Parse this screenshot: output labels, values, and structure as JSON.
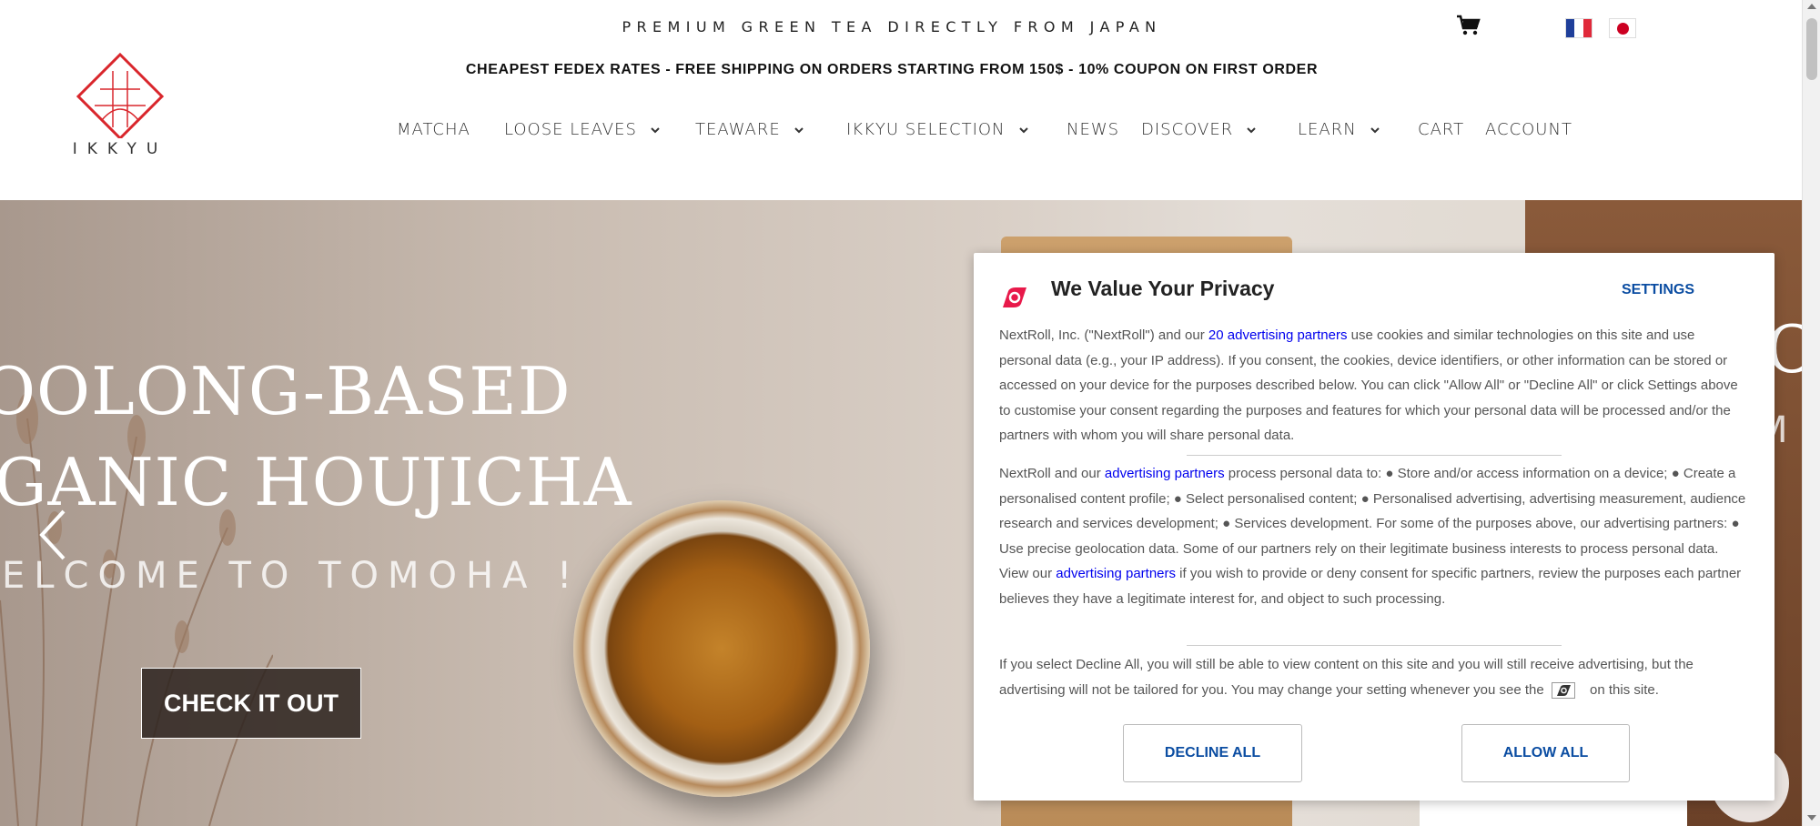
{
  "header": {
    "tagline": "PREMIUM GREEN TEA DIRECTLY FROM JAPAN",
    "promo": "CHEAPEST FEDEX RATES - FREE SHIPPING ON ORDERS STARTING FROM 150$ - 10% COUPON ON FIRST ORDER",
    "logo_text": "IKKYU",
    "brand_color": "#d9262c",
    "icons": [
      "cart-icon",
      "flag-france-icon",
      "flag-japan-icon"
    ]
  },
  "nav": {
    "items": [
      {
        "label": "MATCHA",
        "dropdown": false
      },
      {
        "label": "LOOSE LEAVES",
        "dropdown": true
      },
      {
        "label": "TEAWARE",
        "dropdown": true
      },
      {
        "label": "IKKYU SELECTION",
        "dropdown": true
      },
      {
        "label": "NEWS",
        "dropdown": false
      },
      {
        "label": "DISCOVER",
        "dropdown": true
      },
      {
        "label": "LEARN",
        "dropdown": true
      },
      {
        "label": "CART",
        "dropdown": false
      },
      {
        "label": "ACCOUNT",
        "dropdown": false
      }
    ]
  },
  "hero": {
    "line1": "OOLONG-BASED",
    "line2": "GANIC HOUJICHA",
    "line3": "ELCOME TO TOMOHA !",
    "cta": "CHECK IT OUT",
    "next_slide_line1": "CE",
    "next_slide_line2": "M"
  },
  "privacy": {
    "title": "We Value Your Privacy",
    "settings": "SETTINGS",
    "p1_before": "NextRoll, Inc. (\"NextRoll\") and our ",
    "p1_link": "20 advertising partners",
    "p1_after": " use cookies and similar technologies on this site and use personal data (e.g., your IP address). If you consent, the cookies, device identifiers, or other information can be stored or accessed on your device for the purposes described below. You can click \"Allow All\" or \"Decline All\" or click Settings above to customise your consent regarding the purposes and features for which your personal data will be processed and/or the partners with whom you will share personal data.",
    "p2_before": "NextRoll and our ",
    "p2_link": "advertising partners",
    "p2_middle": " process personal data to: ● Store and/or access information on a device; ● Create a personalised content profile; ● Select personalised content; ● Personalised advertising, advertising measurement, audience research and services development; ● Services development. For some of the purposes above, our advertising partners: ● Use precise geolocation data. Some of our partners rely on their legitimate business interests to process personal data. View our ",
    "p2_link2": "advertising partners",
    "p2_after": " if you wish to provide or deny consent for specific partners, review the purposes each partner believes they have a legitimate interest for, and object to such processing.",
    "p3_before": "If you select Decline All, you will still be able to view content on this site and you will still receive advertising, but the advertising will not be tailored for you. You may change your setting whenever you see the ",
    "p3_after": " on this site.",
    "decline": "DECLINE ALL",
    "allow": "ALLOW ALL",
    "accent_color": "#0b4da2",
    "logo_color": "#e8194a"
  }
}
